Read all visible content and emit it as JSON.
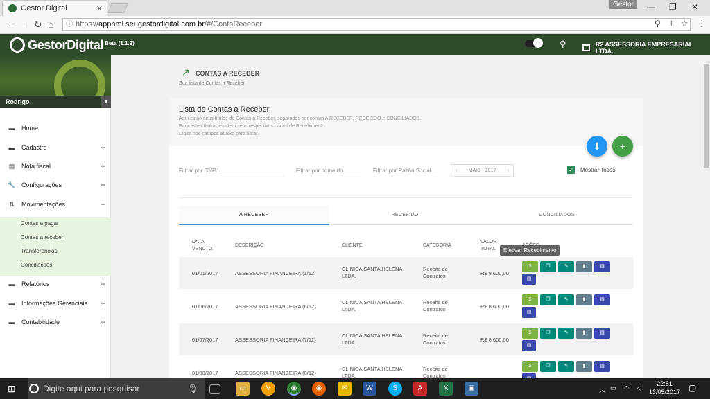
{
  "browser": {
    "tab_title": "Gestor Digital",
    "user_chip": "Gestor",
    "url_scheme": "https://",
    "url_host": "apphml.seugestordigital.com.br",
    "url_path": "/#/ContaReceber"
  },
  "app": {
    "brand": "GestorDigital",
    "version": "Beta (1.1.2)",
    "company": "R2 ASSESSORIA EMPRESARIAL LTDA."
  },
  "sidebar": {
    "user": "Rodrigo",
    "items": [
      {
        "label": "Home",
        "icon": "home-icon",
        "expand": ""
      },
      {
        "label": "Cadastro",
        "icon": "list-icon",
        "expand": "+"
      },
      {
        "label": "Nota fiscal",
        "icon": "receipt-icon",
        "expand": "+"
      },
      {
        "label": "Configurações",
        "icon": "wrench-icon",
        "expand": "+"
      },
      {
        "label": "Movimentações",
        "icon": "swap-icon",
        "expand": "−"
      }
    ],
    "subitems": [
      "Contas a pagar",
      "Contas a receber",
      "Transferências",
      "Conciliações"
    ],
    "items_after": [
      {
        "label": "Relatórios",
        "icon": "report-icon",
        "expand": "+"
      },
      {
        "label": "Informações Gerenciais",
        "icon": "chart-icon",
        "expand": "+"
      },
      {
        "label": "Contabilidade",
        "icon": "ledger-icon",
        "expand": "+"
      }
    ]
  },
  "page": {
    "title": "CONTAS A RECEBER",
    "subtitle": "Sua lista de Contas a Receber"
  },
  "card": {
    "title": "Lista de Contas a Receber",
    "desc1": "Aqui estão seus títulos de Contas a Receber, separados por contas A RECEBER, RECEBIDO e CONCILIADOS.",
    "desc2": "Para estes títulos, existem seus respectivos dados de Recebimento.",
    "desc3": "Digite nos campos abaixo para filtrar."
  },
  "filters": {
    "cnpj": "Filtrar por CNPJ",
    "nome": "Filtrar por nome do",
    "razao": "Filtrar por Razão Social",
    "month": "MAIO - 2017",
    "show_all": "Mostrar Todos"
  },
  "tabs": [
    "A RECEBER",
    "RECEBIDO",
    "CONCILIADOS"
  ],
  "table": {
    "headers": {
      "data1": "DATA",
      "data2": "VENCTO.",
      "descricao": "DESCRIÇÃO",
      "cliente": "CLIENTE",
      "categoria": "CATEGORIA",
      "valor1": "VALOR",
      "valor2": "TOTAL",
      "acoes": "AÇÕES"
    },
    "rows": [
      {
        "data": "01/01/2017",
        "descricao": "ASSESSORIA FINANCEIRA (1/12)",
        "cliente1": "CLINICA SANTA HELENA",
        "cliente2": "LTDA.",
        "cat1": "Receita de",
        "cat2": "Contratos",
        "valor": "R$ 8.600,00"
      },
      {
        "data": "01/06/2017",
        "descricao": "ASSESSORIA FINANCEIRA (6/12)",
        "cliente1": "CLINICA SANTA HELENA",
        "cliente2": "LTDA.",
        "cat1": "Receita de",
        "cat2": "Contratos",
        "valor": "R$ 8.600,00"
      },
      {
        "data": "01/07/2017",
        "descricao": "ASSESSORIA FINANCEIRA (7/12)",
        "cliente1": "CLINICA SANTA HELENA",
        "cliente2": "LTDA.",
        "cat1": "Receita de",
        "cat2": "Contratos",
        "valor": "R$ 8.600,00"
      },
      {
        "data": "01/08/2017",
        "descricao": "ASSESSORIA FINANCEIRA (8/12)",
        "cliente1": "CLINICA SANTA HELENA",
        "cliente2": "LTDA.",
        "cat1": "Receita de",
        "cat2": "Contratos",
        "valor": ""
      }
    ],
    "tooltip": "Efetivar Recebimento"
  },
  "taskbar": {
    "search_placeholder": "Digite aqui para pesquisar",
    "time": "22:51",
    "date": "13/05/2017"
  },
  "colors": {
    "header_green": "#2e4a2b",
    "accent_blue": "#3f8fd2",
    "fab_blue": "#2196f3",
    "fab_green": "#43a047",
    "btn_lime": "#7cb342",
    "btn_teal": "#00897b",
    "btn_gray": "#607d8b",
    "btn_indigo": "#3949ab"
  }
}
